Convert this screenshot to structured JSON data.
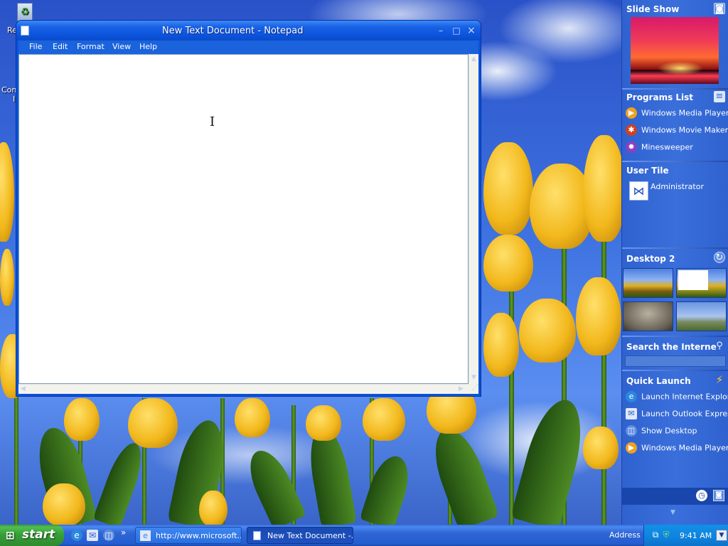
{
  "notepad": {
    "title": "New Text Document - Notepad",
    "menu": [
      "File",
      "Edit",
      "Format",
      "View",
      "Help"
    ],
    "buttons": {
      "minimize": "–",
      "maximize": "□",
      "close": "×"
    }
  },
  "desktop": {
    "icons": [
      {
        "label": "Re",
        "icon": "recycle-bin-icon"
      },
      {
        "label": "Con",
        "icon": "my-computer-icon"
      },
      {
        "label": "I",
        "icon": "internet-icon"
      }
    ]
  },
  "sidebar": {
    "slideshow": {
      "title": "Slide Show"
    },
    "programs": {
      "title": "Programs List",
      "items": [
        {
          "label": "Windows Media Player",
          "icon": "media-player-icon",
          "color": "#f0a020"
        },
        {
          "label": "Windows Movie Maker",
          "icon": "movie-maker-icon",
          "color": "#d04020"
        },
        {
          "label": "Minesweeper",
          "icon": "minesweeper-icon",
          "color": "#8a40c0"
        }
      ]
    },
    "user_tile": {
      "title": "User Tile",
      "user": "Administrator",
      "icon": "butterfly-icon"
    },
    "desktop2": {
      "title": "Desktop 2"
    },
    "search": {
      "title": "Search the Interne"
    },
    "quick_launch": {
      "title": "Quick Launch",
      "items": [
        {
          "label": "Launch Internet Explore",
          "icon": "internet-explorer-icon"
        },
        {
          "label": "Launch Outlook Express",
          "icon": "outlook-express-icon"
        },
        {
          "label": "Show Desktop",
          "icon": "show-desktop-icon"
        },
        {
          "label": "Windows Media Player",
          "icon": "media-player-icon"
        }
      ]
    }
  },
  "taskbar": {
    "start_label": "start",
    "quick_launch_more": "»",
    "tasks": [
      {
        "label": "http://www.microsoft...",
        "icon": "internet-explorer-icon"
      },
      {
        "label": "New Text Document -...",
        "icon": "notepad-icon"
      }
    ],
    "address_label": "Address",
    "clock": "9:41 AM"
  },
  "colors": {
    "xp_blue": "#0a53d8",
    "start_green": "#37a037",
    "tray_blue": "#0f86e0"
  }
}
